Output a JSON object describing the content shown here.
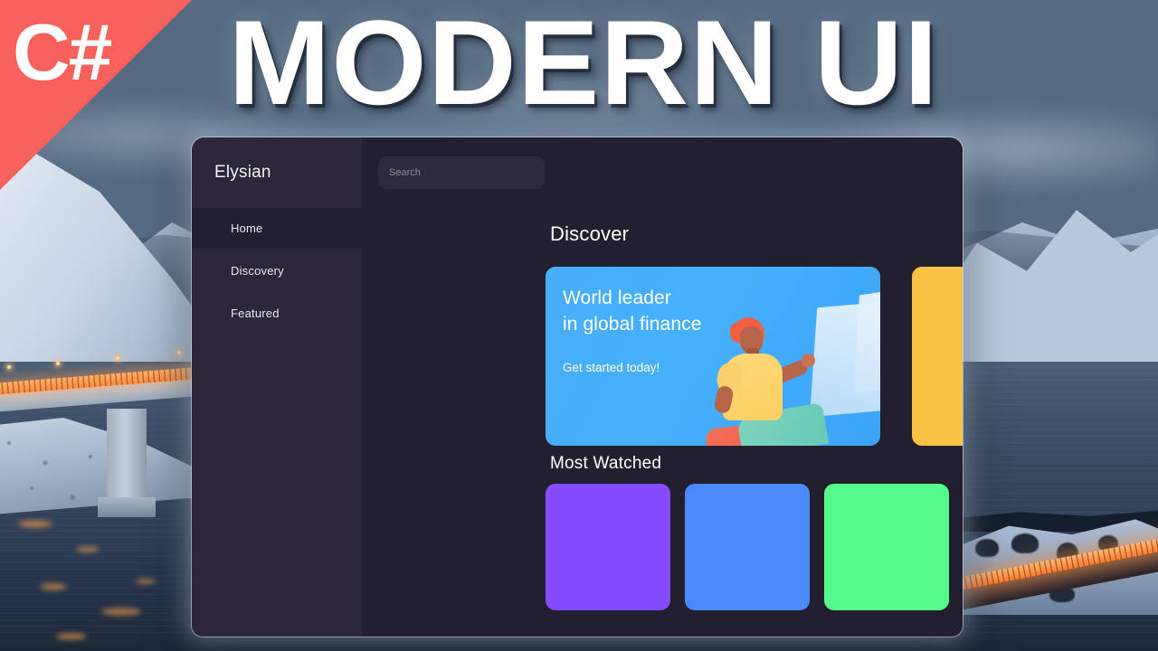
{
  "overlay": {
    "title": "MODERN UI",
    "badge_label": "C#",
    "badge_color": "#f8605c"
  },
  "app": {
    "brand": "Elysian",
    "window_bg": "#221f2e",
    "sidebar_bg": "#2b2739",
    "sidebar": {
      "items": [
        {
          "label": "Home",
          "active": true
        },
        {
          "label": "Discovery",
          "active": false
        },
        {
          "label": "Featured",
          "active": false
        }
      ]
    },
    "search": {
      "placeholder": "Search",
      "value": ""
    },
    "sections": [
      {
        "heading": "Discover"
      },
      {
        "heading": "Most Watched"
      }
    ],
    "discover": {
      "heading": "Discover",
      "banner": {
        "line1": "World leader",
        "line2": "in global finance",
        "subtitle": "Get started today!",
        "color": "#46b0fd",
        "illustration": "person-with-screen-illustration"
      },
      "side_card": {
        "color": "#fcc244"
      }
    },
    "most_watched": {
      "heading": "Most Watched",
      "tiles": [
        {
          "color": "#844afe"
        },
        {
          "color": "#4a8afe"
        },
        {
          "color": "#54fb8c"
        },
        {
          "color": "#eefb4e"
        }
      ]
    }
  }
}
